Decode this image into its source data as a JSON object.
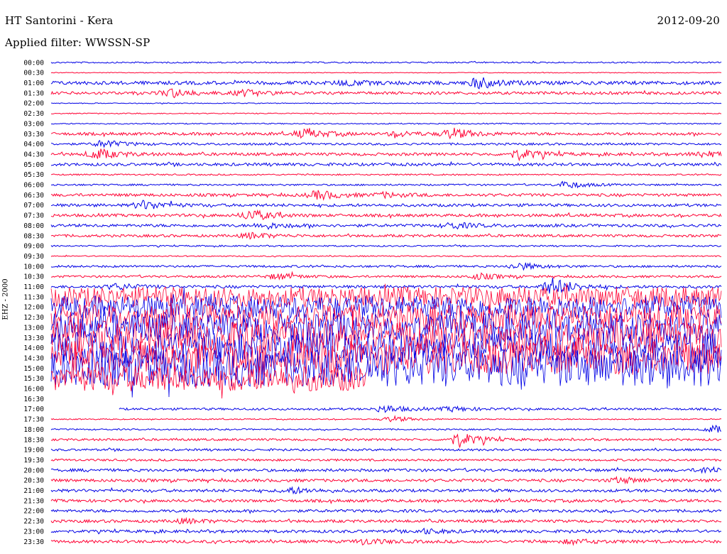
{
  "header": {
    "title": "HT Santorini - Kera",
    "date": "2012-09-20",
    "filter": "Applied filter: WWSSN-SP",
    "channel": "EHZ - 2000"
  },
  "colors": {
    "odd_trace": "#0000e6",
    "even_trace": "#ff0033",
    "background": "#ffffff",
    "text": "#000000"
  },
  "chart_data": {
    "type": "line",
    "title": "HT Santorini - Kera",
    "subtitle": "Applied filter: WWSSN-SP",
    "ylabel": "EHZ - 2000",
    "xlabel": "",
    "grid": false,
    "legend": "none",
    "x_range_minutes": [
      0,
      30
    ],
    "rows": [
      {
        "time": "00:00",
        "amp": 1.0,
        "gap": [
          0,
          0
        ]
      },
      {
        "time": "00:30",
        "amp": 0.5,
        "gap": [
          0,
          0
        ]
      },
      {
        "time": "01:00",
        "amp": 2.5,
        "gap": [
          0,
          0
        ],
        "events": [
          {
            "t": 0.64,
            "a": 7
          },
          {
            "t": 0.44,
            "a": 3
          }
        ]
      },
      {
        "time": "01:30",
        "amp": 2.0,
        "gap": [
          0,
          0
        ],
        "events": [
          {
            "t": 0.18,
            "a": 6
          },
          {
            "t": 0.29,
            "a": 4
          }
        ]
      },
      {
        "time": "02:00",
        "amp": 0.6,
        "gap": [
          0,
          0
        ]
      },
      {
        "time": "02:30",
        "amp": 0.7,
        "gap": [
          0,
          0
        ]
      },
      {
        "time": "03:00",
        "amp": 0.8,
        "gap": [
          0,
          0
        ]
      },
      {
        "time": "03:30",
        "amp": 2.0,
        "gap": [
          0,
          0
        ],
        "events": [
          {
            "t": 0.38,
            "a": 6
          },
          {
            "t": 0.6,
            "a": 7
          },
          {
            "t": 0.52,
            "a": 3
          }
        ]
      },
      {
        "time": "04:00",
        "amp": 1.5,
        "gap": [
          0,
          0
        ],
        "events": [
          {
            "t": 0.08,
            "a": 5
          }
        ]
      },
      {
        "time": "04:30",
        "amp": 2.0,
        "gap": [
          0,
          0
        ],
        "events": [
          {
            "t": 0.07,
            "a": 7
          },
          {
            "t": 0.7,
            "a": 7
          },
          {
            "t": 0.97,
            "a": 4
          }
        ]
      },
      {
        "time": "05:00",
        "amp": 2.0,
        "gap": [
          0,
          0
        ]
      },
      {
        "time": "05:30",
        "amp": 1.0,
        "gap": [
          0,
          0
        ]
      },
      {
        "time": "06:00",
        "amp": 1.2,
        "gap": [
          0,
          0
        ],
        "events": [
          {
            "t": 0.77,
            "a": 5
          }
        ]
      },
      {
        "time": "06:30",
        "amp": 2.0,
        "gap": [
          0,
          0
        ],
        "events": [
          {
            "t": 0.4,
            "a": 6
          },
          {
            "t": 0.5,
            "a": 3
          }
        ]
      },
      {
        "time": "07:00",
        "amp": 2.0,
        "gap": [
          0,
          0
        ],
        "events": [
          {
            "t": 0.14,
            "a": 6
          }
        ]
      },
      {
        "time": "07:30",
        "amp": 2.0,
        "gap": [
          0,
          0
        ],
        "events": [
          {
            "t": 0.3,
            "a": 7
          }
        ]
      },
      {
        "time": "08:00",
        "amp": 2.0,
        "gap": [
          0,
          0
        ],
        "events": [
          {
            "t": 0.32,
            "a": 4
          },
          {
            "t": 0.6,
            "a": 4
          }
        ]
      },
      {
        "time": "08:30",
        "amp": 1.8,
        "gap": [
          0,
          0
        ],
        "events": [
          {
            "t": 0.3,
            "a": 4
          }
        ]
      },
      {
        "time": "09:00",
        "amp": 1.0,
        "gap": [
          0,
          0
        ]
      },
      {
        "time": "09:30",
        "amp": 0.8,
        "gap": [
          0,
          0
        ]
      },
      {
        "time": "10:00",
        "amp": 1.5,
        "gap": [
          0,
          0
        ],
        "events": [
          {
            "t": 0.7,
            "a": 5
          }
        ]
      },
      {
        "time": "10:30",
        "amp": 1.5,
        "gap": [
          0,
          0
        ],
        "events": [
          {
            "t": 0.34,
            "a": 4
          },
          {
            "t": 0.64,
            "a": 4
          }
        ]
      },
      {
        "time": "11:00",
        "amp": 2.0,
        "gap": [
          0,
          0
        ],
        "events": [
          {
            "t": 0.1,
            "a": 4
          },
          {
            "t": 0.75,
            "a": 12
          }
        ]
      },
      {
        "time": "11:30",
        "amp": 14,
        "gap": [
          0,
          0
        ]
      },
      {
        "time": "12:00",
        "amp": 16,
        "gap": [
          0,
          0
        ]
      },
      {
        "time": "12:30",
        "amp": 18,
        "gap": [
          0,
          0
        ]
      },
      {
        "time": "13:00",
        "amp": 20,
        "gap": [
          0,
          0
        ]
      },
      {
        "time": "13:30",
        "amp": 22,
        "gap": [
          0,
          0
        ]
      },
      {
        "time": "14:00",
        "amp": 22,
        "gap": [
          0,
          0
        ]
      },
      {
        "time": "14:30",
        "amp": 24,
        "gap": [
          0,
          0
        ]
      },
      {
        "time": "15:00",
        "amp": 26,
        "gap": [
          0,
          0
        ]
      },
      {
        "time": "15:30",
        "amp": 18,
        "gap": [
          0.47,
          1
        ]
      },
      {
        "time": "16:00",
        "amp": 0,
        "gap": [
          0,
          1
        ]
      },
      {
        "time": "16:30",
        "amp": 0,
        "gap": [
          0,
          1
        ]
      },
      {
        "time": "17:00",
        "amp": 1.5,
        "gap": [
          0,
          0.1
        ],
        "events": [
          {
            "t": 0.5,
            "a": 5
          },
          {
            "t": 0.6,
            "a": 3
          }
        ]
      },
      {
        "time": "17:30",
        "amp": 0.8,
        "gap": [
          0,
          0
        ],
        "events": [
          {
            "t": 0.51,
            "a": 4
          }
        ]
      },
      {
        "time": "18:00",
        "amp": 1.0,
        "gap": [
          0,
          0
        ],
        "events": [
          {
            "t": 0.99,
            "a": 5
          }
        ]
      },
      {
        "time": "18:30",
        "amp": 1.5,
        "gap": [
          0,
          0
        ],
        "events": [
          {
            "t": 0.61,
            "a": 10
          }
        ]
      },
      {
        "time": "19:00",
        "amp": 1.5,
        "gap": [
          0,
          0
        ]
      },
      {
        "time": "19:30",
        "amp": 1.5,
        "gap": [
          0,
          0
        ]
      },
      {
        "time": "20:00",
        "amp": 2.0,
        "gap": [
          0,
          0
        ],
        "events": [
          {
            "t": 0.98,
            "a": 4
          }
        ]
      },
      {
        "time": "20:30",
        "amp": 2.0,
        "gap": [
          0,
          0
        ],
        "events": [
          {
            "t": 0.85,
            "a": 4
          }
        ]
      },
      {
        "time": "21:00",
        "amp": 2.0,
        "gap": [
          0,
          0
        ],
        "events": [
          {
            "t": 0.36,
            "a": 4
          }
        ]
      },
      {
        "time": "21:30",
        "amp": 2.0,
        "gap": [
          0,
          0
        ]
      },
      {
        "time": "22:00",
        "amp": 2.0,
        "gap": [
          0,
          0
        ]
      },
      {
        "time": "22:30",
        "amp": 2.0,
        "gap": [
          0,
          0
        ],
        "events": [
          {
            "t": 0.2,
            "a": 3
          }
        ]
      },
      {
        "time": "23:00",
        "amp": 2.0,
        "gap": [
          0,
          0
        ],
        "events": [
          {
            "t": 0.56,
            "a": 3
          }
        ]
      },
      {
        "time": "23:30",
        "amp": 2.0,
        "gap": [
          0,
          0
        ],
        "events": [
          {
            "t": 0.47,
            "a": 4
          },
          {
            "t": 0.78,
            "a": 3
          }
        ]
      }
    ]
  }
}
